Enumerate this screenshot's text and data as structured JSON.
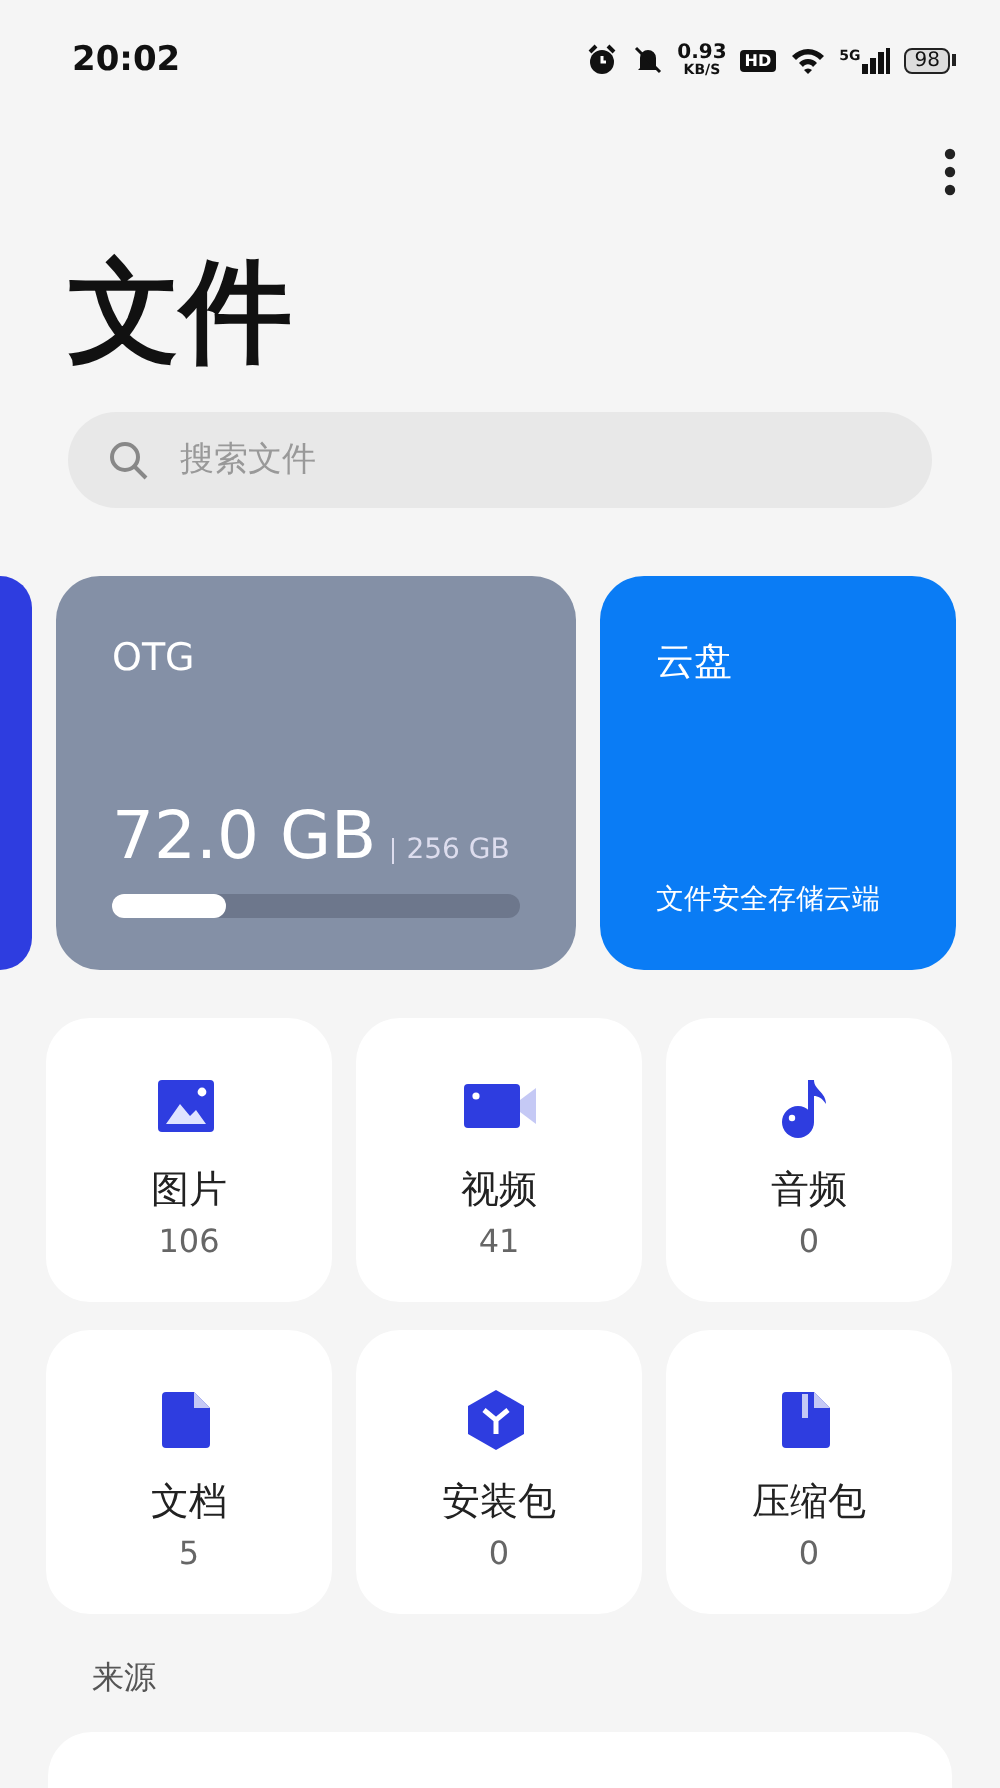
{
  "status_bar": {
    "time": "20:02",
    "speed": "0.93",
    "speed_unit": "KB/S",
    "hd": "HD",
    "network": "5G",
    "battery": "98"
  },
  "title": "文件",
  "search": {
    "placeholder": "搜索文件"
  },
  "storage_cards": [
    {
      "kind": "partial"
    },
    {
      "kind": "device",
      "name": "OTG",
      "used": "72.0 GB",
      "total": "256 GB",
      "level": 0.28
    },
    {
      "kind": "cloud",
      "name": "云盘",
      "subtitle": "文件安全存储云端"
    }
  ],
  "categories": [
    {
      "kind": "image",
      "label": "图片",
      "count": "106"
    },
    {
      "kind": "video",
      "label": "视频",
      "count": "41"
    },
    {
      "kind": "audio",
      "label": "音频",
      "count": "0"
    },
    {
      "kind": "document",
      "label": "文档",
      "count": "5"
    },
    {
      "kind": "package",
      "label": "安装包",
      "count": "0"
    },
    {
      "kind": "archive",
      "label": "压缩包",
      "count": "0"
    }
  ],
  "section_title": "来源"
}
